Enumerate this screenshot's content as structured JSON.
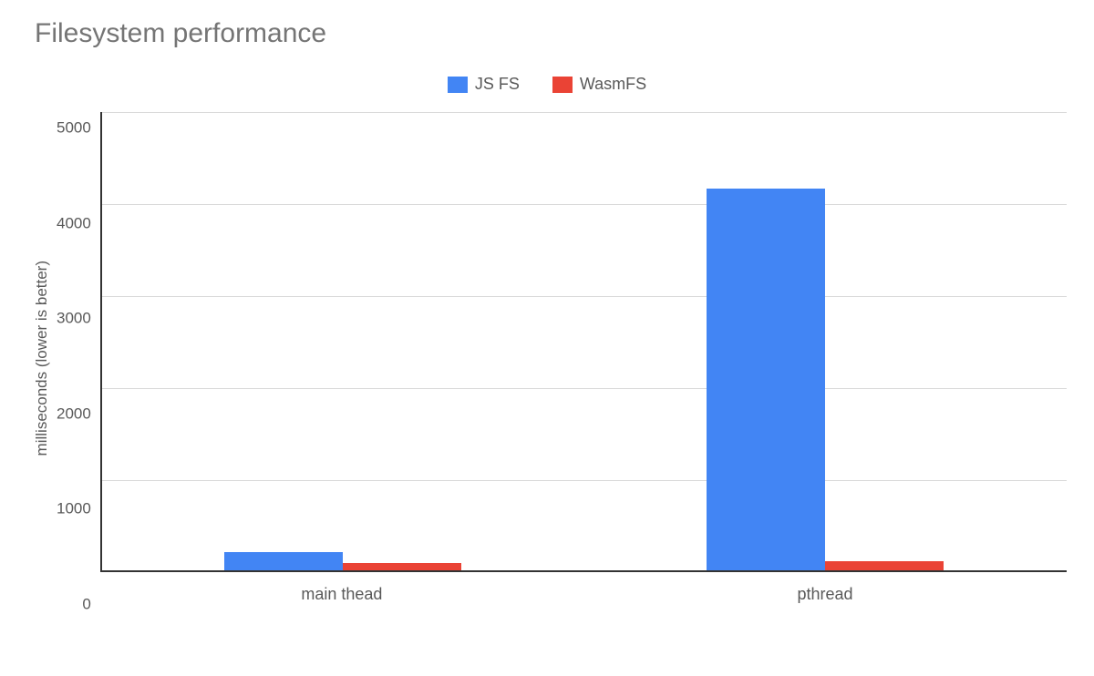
{
  "chart_data": {
    "type": "bar",
    "title": "Filesystem performance",
    "ylabel": "milliseconds (lower is better)",
    "xlabel": "",
    "ylim": [
      0,
      5000
    ],
    "yticks": [
      0,
      1000,
      2000,
      3000,
      4000,
      5000
    ],
    "categories": [
      "main thead",
      "pthread"
    ],
    "series": [
      {
        "name": "JS FS",
        "color": "#4285f4",
        "values": [
          220,
          4170
        ]
      },
      {
        "name": "WasmFS",
        "color": "#ea4335",
        "values": [
          100,
          120
        ]
      }
    ],
    "legend_position": "top",
    "grid": true
  }
}
